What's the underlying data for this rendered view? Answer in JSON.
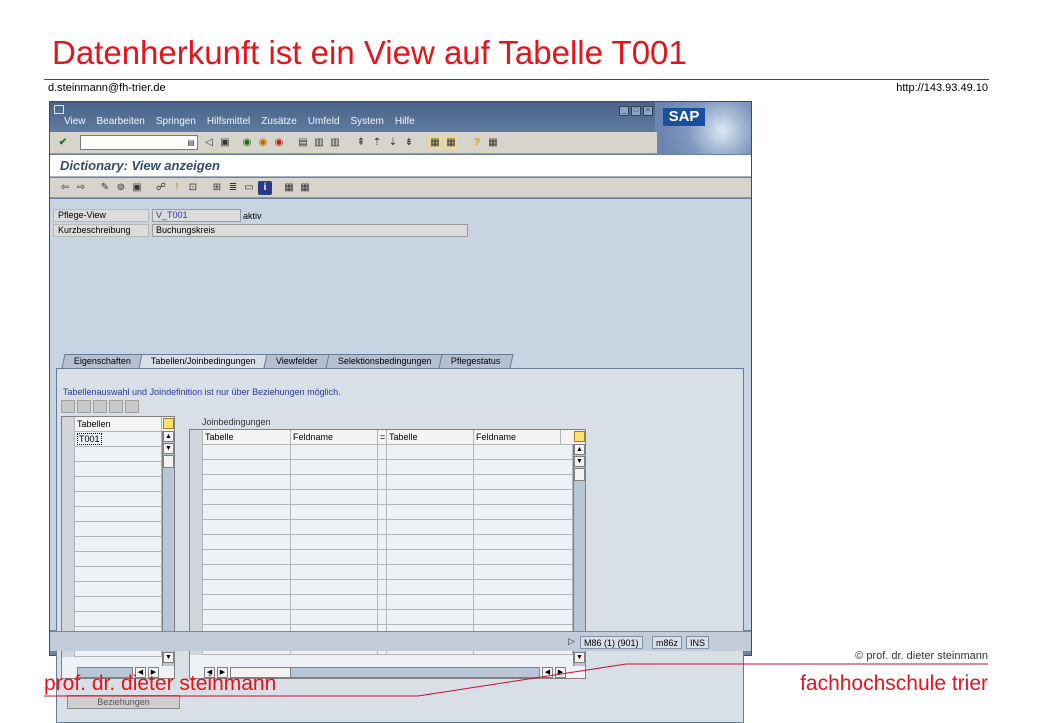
{
  "slide": {
    "title": "Datenherkunft ist ein View auf Tabelle T001",
    "email": "d.steinmann@fh-trier.de",
    "url": "http://143.93.49.10",
    "copyright": "© prof. dr. dieter steinmann",
    "footer_left": "prof. dr. dieter steinmann",
    "footer_right": "fachhochschule trier",
    "accent_color": "#e8131a"
  },
  "sap": {
    "logo": "SAP",
    "menu": [
      "View",
      "Bearbeiten",
      "Springen",
      "Hilfsmittel",
      "Zusätze",
      "Umfeld",
      "System",
      "Hilfe"
    ],
    "screen_title": "Dictionary: View anzeigen",
    "fields": {
      "pflege_view_label": "Pflege-View",
      "pflege_view_value": "V_T001",
      "status": "aktiv",
      "kurzbeschreibung_label": "Kurzbeschreibung",
      "kurzbeschreibung_value": "Buchungskreis"
    },
    "tabs": [
      "Eigenschaften",
      "Tabellen/Joinbedingungen",
      "Viewfelder",
      "Selektionsbedingungen",
      "Pflegestatus"
    ],
    "active_tab": "Tabellen/Joinbedingungen",
    "info_text": "Tabellenauswahl und Joindefinition ist nur über Beziehungen möglich.",
    "tables_grid": {
      "header": "Tabellen",
      "rows": [
        "T001"
      ]
    },
    "join_grid": {
      "title": "Joinbedingungen",
      "headers": [
        "Tabelle",
        "Feldname",
        "=",
        "Tabelle",
        "Feldname"
      ]
    },
    "button_beziehungen": "Beziehungen",
    "status": {
      "system": "M86 (1) (901)",
      "host": "m86z",
      "mode": "INS"
    }
  }
}
